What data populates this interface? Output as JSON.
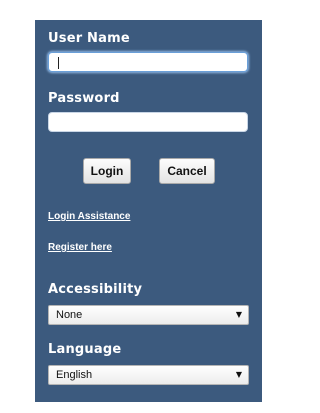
{
  "login_form": {
    "username_label": "User Name",
    "username_value": "",
    "password_label": "Password",
    "password_value": "",
    "login_button": "Login",
    "cancel_button": "Cancel",
    "login_assistance_link": "Login Assistance",
    "register_link": "Register here"
  },
  "accessibility": {
    "label": "Accessibility",
    "selected": "None"
  },
  "language": {
    "label": "Language",
    "selected": "English"
  },
  "icons": {
    "dropdown_arrow": "▼"
  },
  "colors": {
    "panel_background": "#3c5a7e",
    "label_text": "#ffffff"
  }
}
